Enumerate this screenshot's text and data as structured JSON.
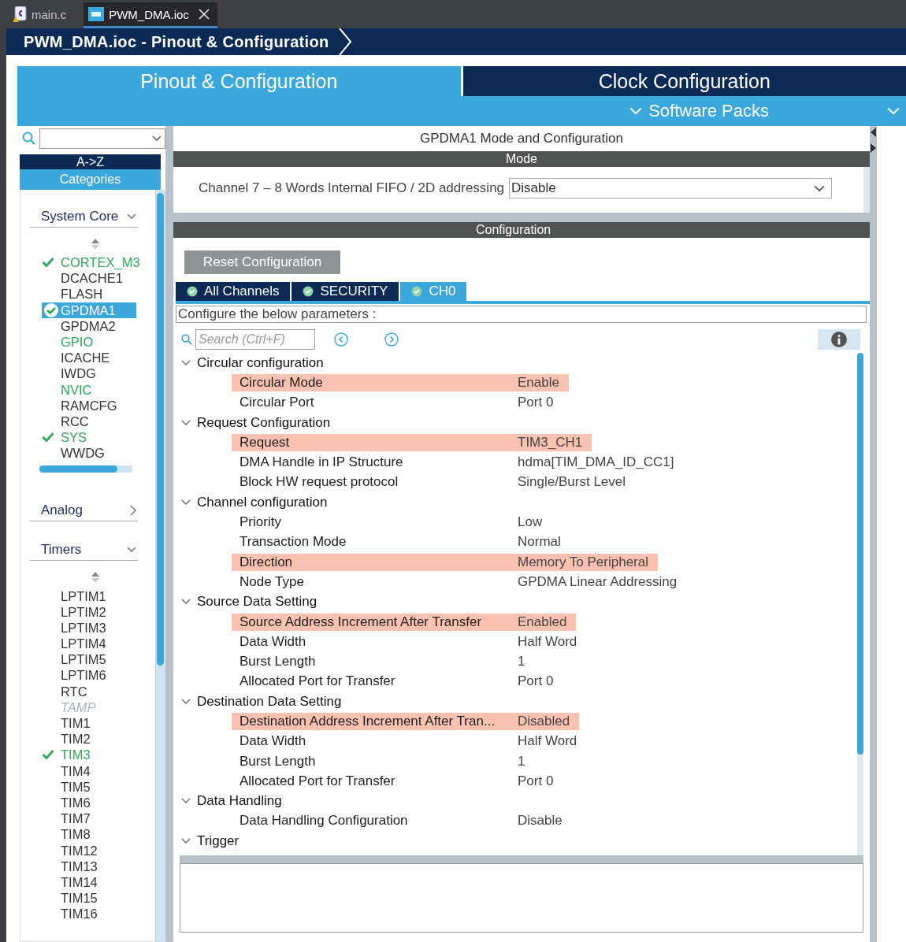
{
  "editor_tabs": [
    {
      "label": "main.c",
      "kind": "c",
      "selected": false
    },
    {
      "label": "PWM_DMA.ioc",
      "kind": "mx",
      "selected": true
    }
  ],
  "breadcrumb": "PWM_DMA.ioc - Pinout & Configuration",
  "main_tabs": [
    {
      "label": "Pinout & Configuration",
      "selected": true
    },
    {
      "label": "Clock Configuration",
      "selected": false
    }
  ],
  "software_packs": "Software Packs",
  "sidebar": {
    "sort_az": "A->Z",
    "categories": "Categories",
    "groups": [
      {
        "label": "System Core",
        "expanded": true,
        "items": [
          {
            "label": "CORTEX_M3",
            "checked": true,
            "active": true,
            "disabled": false,
            "selected": false
          },
          {
            "label": "DCACHE1",
            "checked": false,
            "active": false,
            "disabled": false,
            "selected": false
          },
          {
            "label": "FLASH",
            "checked": false,
            "active": false,
            "disabled": false,
            "selected": false
          },
          {
            "label": "GPDMA1",
            "checked": true,
            "active": true,
            "disabled": false,
            "selected": true
          },
          {
            "label": "GPDMA2",
            "checked": false,
            "active": false,
            "disabled": false,
            "selected": false
          },
          {
            "label": "GPIO",
            "checked": false,
            "active": true,
            "disabled": false,
            "selected": false
          },
          {
            "label": "ICACHE",
            "checked": false,
            "active": false,
            "disabled": false,
            "selected": false
          },
          {
            "label": "IWDG",
            "checked": false,
            "active": false,
            "disabled": false,
            "selected": false
          },
          {
            "label": "NVIC",
            "checked": false,
            "active": true,
            "disabled": false,
            "selected": false
          },
          {
            "label": "RAMCFG",
            "checked": false,
            "active": false,
            "disabled": false,
            "selected": false
          },
          {
            "label": "RCC",
            "checked": false,
            "active": false,
            "disabled": false,
            "selected": false
          },
          {
            "label": "SYS",
            "checked": true,
            "active": true,
            "disabled": false,
            "selected": false
          },
          {
            "label": "WWDG",
            "checked": false,
            "active": false,
            "disabled": false,
            "selected": false
          }
        ]
      },
      {
        "label": "Analog",
        "expanded": false
      },
      {
        "label": "Timers",
        "expanded": true,
        "items": [
          {
            "label": "LPTIM1",
            "checked": false,
            "active": false,
            "disabled": false,
            "selected": false
          },
          {
            "label": "LPTIM2",
            "checked": false,
            "active": false,
            "disabled": false,
            "selected": false
          },
          {
            "label": "LPTIM3",
            "checked": false,
            "active": false,
            "disabled": false,
            "selected": false
          },
          {
            "label": "LPTIM4",
            "checked": false,
            "active": false,
            "disabled": false,
            "selected": false
          },
          {
            "label": "LPTIM5",
            "checked": false,
            "active": false,
            "disabled": false,
            "selected": false
          },
          {
            "label": "LPTIM6",
            "checked": false,
            "active": false,
            "disabled": false,
            "selected": false
          },
          {
            "label": "RTC",
            "checked": false,
            "active": false,
            "disabled": false,
            "selected": false
          },
          {
            "label": "TAMP",
            "checked": false,
            "active": false,
            "disabled": true,
            "selected": false
          },
          {
            "label": "TIM1",
            "checked": false,
            "active": false,
            "disabled": false,
            "selected": false
          },
          {
            "label": "TIM2",
            "checked": false,
            "active": false,
            "disabled": false,
            "selected": false
          },
          {
            "label": "TIM3",
            "checked": true,
            "active": true,
            "disabled": false,
            "selected": false
          },
          {
            "label": "TIM4",
            "checked": false,
            "active": false,
            "disabled": false,
            "selected": false
          },
          {
            "label": "TIM5",
            "checked": false,
            "active": false,
            "disabled": false,
            "selected": false
          },
          {
            "label": "TIM6",
            "checked": false,
            "active": false,
            "disabled": false,
            "selected": false
          },
          {
            "label": "TIM7",
            "checked": false,
            "active": false,
            "disabled": false,
            "selected": false
          },
          {
            "label": "TIM8",
            "checked": false,
            "active": false,
            "disabled": false,
            "selected": false
          },
          {
            "label": "TIM12",
            "checked": false,
            "active": false,
            "disabled": false,
            "selected": false
          },
          {
            "label": "TIM13",
            "checked": false,
            "active": false,
            "disabled": false,
            "selected": false
          },
          {
            "label": "TIM14",
            "checked": false,
            "active": false,
            "disabled": false,
            "selected": false
          },
          {
            "label": "TIM15",
            "checked": false,
            "active": false,
            "disabled": false,
            "selected": false
          },
          {
            "label": "TIM16",
            "checked": false,
            "active": false,
            "disabled": false,
            "selected": false
          }
        ]
      }
    ]
  },
  "panel_title": "GPDMA1 Mode and Configuration",
  "mode": {
    "title": "Mode",
    "rows": [
      {
        "label": "Channel 7  – 8 Words Internal FIFO / 2D addressing",
        "value": "Disable"
      }
    ]
  },
  "configuration": {
    "title": "Configuration",
    "reset_button": "Reset Configuration",
    "tabs": [
      {
        "label": "All Channels",
        "selected": false
      },
      {
        "label": "SECURITY",
        "selected": false
      },
      {
        "label": "CH0",
        "selected": true
      }
    ],
    "description": "Configure the below parameters :",
    "search": {
      "placeholder": "Search (Ctrl+F)"
    },
    "groups": [
      {
        "label": "Circular configuration",
        "expanded": true,
        "children": [
          {
            "name": "Circular Mode",
            "value": "Enable",
            "highlighted": true
          },
          {
            "name": "Circular Port",
            "value": "Port 0",
            "highlighted": false
          }
        ]
      },
      {
        "label": "Request Configuration",
        "expanded": true,
        "children": [
          {
            "name": "Request",
            "value": "TIM3_CH1",
            "highlighted": true
          },
          {
            "name": "DMA Handle in IP Structure",
            "value": "hdma[TIM_DMA_ID_CC1]",
            "highlighted": false
          },
          {
            "name": "Block HW request protocol",
            "value": "Single/Burst Level",
            "highlighted": false
          }
        ]
      },
      {
        "label": "Channel configuration",
        "expanded": true,
        "children": [
          {
            "name": "Priority",
            "value": "Low",
            "highlighted": false
          },
          {
            "name": "Transaction Mode",
            "value": "Normal",
            "highlighted": false
          },
          {
            "name": "Direction",
            "value": "Memory To Peripheral",
            "highlighted": true
          },
          {
            "name": "Node Type",
            "value": "GPDMA Linear Addressing",
            "highlighted": false
          }
        ]
      },
      {
        "label": "Source Data Setting",
        "expanded": true,
        "children": [
          {
            "name": "Source Address Increment After Transfer",
            "value": "Enabled",
            "highlighted": true
          },
          {
            "name": "Data Width",
            "value": "Half Word",
            "highlighted": false
          },
          {
            "name": "Burst Length",
            "value": "1",
            "highlighted": false
          },
          {
            "name": "Allocated Port for Transfer",
            "value": "Port 0",
            "highlighted": false
          }
        ]
      },
      {
        "label": "Destination Data Setting",
        "expanded": true,
        "children": [
          {
            "name": "Destination Address Increment After Tran...",
            "value": "Disabled",
            "highlighted": true
          },
          {
            "name": "Data Width",
            "value": "Half Word",
            "highlighted": false
          },
          {
            "name": "Burst Length",
            "value": "1",
            "highlighted": false
          },
          {
            "name": "Allocated Port for Transfer",
            "value": "Port 0",
            "highlighted": false
          }
        ]
      },
      {
        "label": "Data Handling",
        "expanded": true,
        "children": [
          {
            "name": "Data Handling Configuration",
            "value": "Disable",
            "highlighted": false
          }
        ]
      },
      {
        "label": "Trigger",
        "expanded": true
      }
    ]
  }
}
